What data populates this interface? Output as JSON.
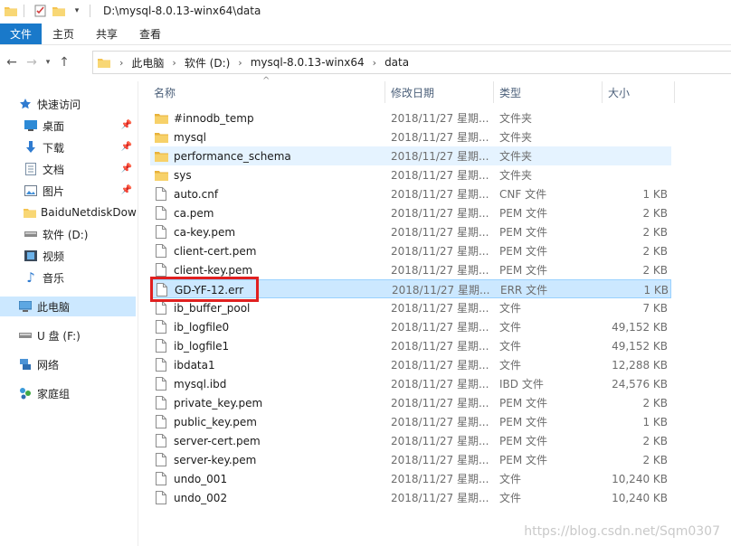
{
  "window": {
    "path_title": "D:\\mysql-8.0.13-winx64\\data"
  },
  "ribbon": {
    "tabs": [
      "文件",
      "主页",
      "共享",
      "查看"
    ]
  },
  "breadcrumb": [
    "此电脑",
    "软件 (D:)",
    "mysql-8.0.13-winx64",
    "data"
  ],
  "sidebar": {
    "items": [
      {
        "label": "快速访问",
        "icon": "star-icon",
        "pinned": false
      },
      {
        "label": "桌面",
        "icon": "desktop-icon",
        "pinned": true
      },
      {
        "label": "下载",
        "icon": "download-icon",
        "pinned": true
      },
      {
        "label": "文档",
        "icon": "document-icon",
        "pinned": true
      },
      {
        "label": "图片",
        "icon": "picture-icon",
        "pinned": true
      },
      {
        "label": "BaiduNetdiskDow",
        "icon": "folder-icon",
        "pinned": false
      },
      {
        "label": "软件 (D:)",
        "icon": "drive-icon",
        "pinned": false
      },
      {
        "label": "视频",
        "icon": "video-icon",
        "pinned": false
      },
      {
        "label": "音乐",
        "icon": "music-icon",
        "pinned": false
      },
      {
        "label": "此电脑",
        "icon": "computer-icon",
        "pinned": false,
        "selected": true
      },
      {
        "label": "U 盘 (F:)",
        "icon": "usb-drive-icon",
        "pinned": false
      },
      {
        "label": "网络",
        "icon": "network-icon",
        "pinned": false
      },
      {
        "label": "家庭组",
        "icon": "homegroup-icon",
        "pinned": false
      }
    ]
  },
  "columns": {
    "name": "名称",
    "date": "修改日期",
    "type": "类型",
    "size": "大小"
  },
  "files": [
    {
      "name": "#innodb_temp",
      "date": "2018/11/27 星期...",
      "type": "文件夹",
      "size": "",
      "kind": "folder"
    },
    {
      "name": "mysql",
      "date": "2018/11/27 星期...",
      "type": "文件夹",
      "size": "",
      "kind": "folder"
    },
    {
      "name": "performance_schema",
      "date": "2018/11/27 星期...",
      "type": "文件夹",
      "size": "",
      "kind": "folder",
      "state": "hover"
    },
    {
      "name": "sys",
      "date": "2018/11/27 星期...",
      "type": "文件夹",
      "size": "",
      "kind": "folder"
    },
    {
      "name": "auto.cnf",
      "date": "2018/11/27 星期...",
      "type": "CNF 文件",
      "size": "1 KB",
      "kind": "file"
    },
    {
      "name": "ca.pem",
      "date": "2018/11/27 星期...",
      "type": "PEM 文件",
      "size": "2 KB",
      "kind": "file"
    },
    {
      "name": "ca-key.pem",
      "date": "2018/11/27 星期...",
      "type": "PEM 文件",
      "size": "2 KB",
      "kind": "file"
    },
    {
      "name": "client-cert.pem",
      "date": "2018/11/27 星期...",
      "type": "PEM 文件",
      "size": "2 KB",
      "kind": "file"
    },
    {
      "name": "client-key.pem",
      "date": "2018/11/27 星期...",
      "type": "PEM 文件",
      "size": "2 KB",
      "kind": "file"
    },
    {
      "name": "GD-YF-12.err",
      "date": "2018/11/27 星期...",
      "type": "ERR 文件",
      "size": "1 KB",
      "kind": "file",
      "state": "selected"
    },
    {
      "name": "ib_buffer_pool",
      "date": "2018/11/27 星期...",
      "type": "文件",
      "size": "7 KB",
      "kind": "file"
    },
    {
      "name": "ib_logfile0",
      "date": "2018/11/27 星期...",
      "type": "文件",
      "size": "49,152 KB",
      "kind": "file"
    },
    {
      "name": "ib_logfile1",
      "date": "2018/11/27 星期...",
      "type": "文件",
      "size": "49,152 KB",
      "kind": "file"
    },
    {
      "name": "ibdata1",
      "date": "2018/11/27 星期...",
      "type": "文件",
      "size": "12,288 KB",
      "kind": "file"
    },
    {
      "name": "mysql.ibd",
      "date": "2018/11/27 星期...",
      "type": "IBD 文件",
      "size": "24,576 KB",
      "kind": "file"
    },
    {
      "name": "private_key.pem",
      "date": "2018/11/27 星期...",
      "type": "PEM 文件",
      "size": "2 KB",
      "kind": "file"
    },
    {
      "name": "public_key.pem",
      "date": "2018/11/27 星期...",
      "type": "PEM 文件",
      "size": "1 KB",
      "kind": "file"
    },
    {
      "name": "server-cert.pem",
      "date": "2018/11/27 星期...",
      "type": "PEM 文件",
      "size": "2 KB",
      "kind": "file"
    },
    {
      "name": "server-key.pem",
      "date": "2018/11/27 星期...",
      "type": "PEM 文件",
      "size": "2 KB",
      "kind": "file"
    },
    {
      "name": "undo_001",
      "date": "2018/11/27 星期...",
      "type": "文件",
      "size": "10,240 KB",
      "kind": "file"
    },
    {
      "name": "undo_002",
      "date": "2018/11/27 星期...",
      "type": "文件",
      "size": "10,240 KB",
      "kind": "file"
    }
  ],
  "watermark": "https://blog.csdn.net/Sqm0307",
  "colors": {
    "ribbon_primary": "#1979ca",
    "selection": "#cce8ff",
    "hover": "#e5f3ff",
    "highlight_box": "#e02020",
    "folder": "#f5c451"
  }
}
